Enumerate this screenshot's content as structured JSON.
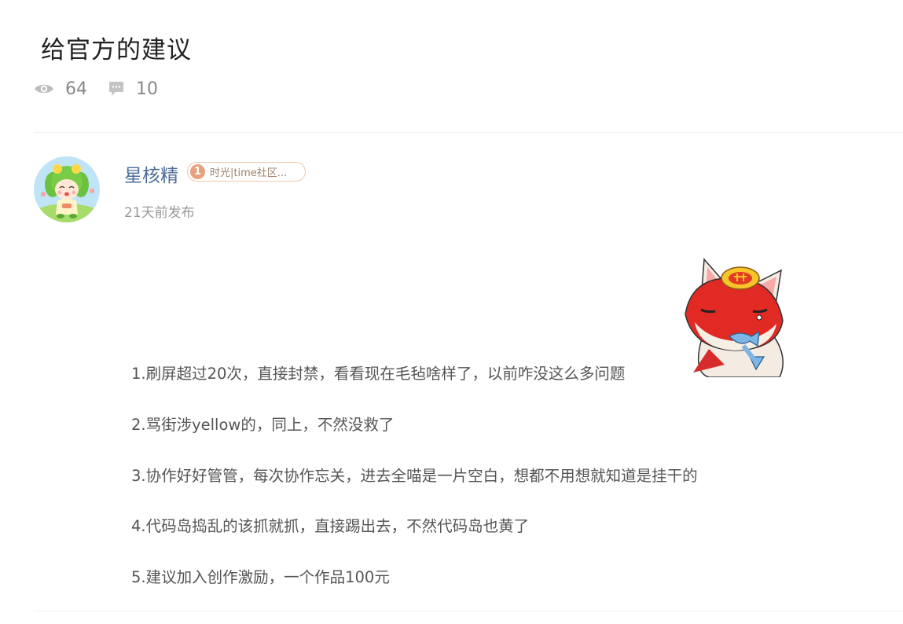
{
  "post": {
    "title": "给官方的建议",
    "views": "64",
    "comments": "10"
  },
  "author": {
    "name": "星核精",
    "badge_level": "1",
    "badge_text": "时光|time社区...",
    "time": "21天前发布"
  },
  "content": {
    "lines": [
      "1.刷屏超过20次，直接封禁，看看现在毛毡啥样了，以前咋没这么多问题",
      "2.骂街涉yellow的，同上，不然没救了",
      "3.协作好好管管，每次协作忘关，进去全喵是一片空白，想都不用想就知道是挂干的",
      "4.代码岛捣乱的该抓就抓，直接踢出去，不然代码岛也黄了",
      "5.建议加入创作激励，一个作品100元"
    ]
  },
  "colors": {
    "author_name": "#4c6d9a",
    "badge_border": "#f2c4a6",
    "badge_level_bg": "#e8a07e"
  },
  "icons": {
    "views": "eye-icon",
    "comments": "comment-bubble-icon"
  }
}
